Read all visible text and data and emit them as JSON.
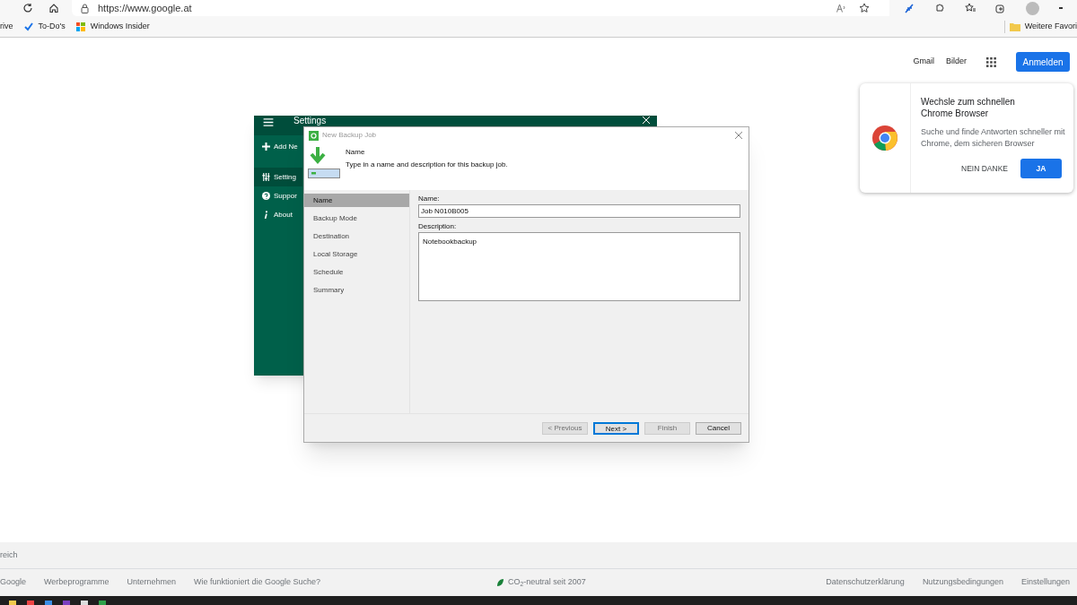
{
  "browser": {
    "url": "https://www.google.at",
    "favorites": [
      {
        "label": "rive",
        "kind": "text"
      },
      {
        "label": "To-Do's",
        "kind": "todo"
      },
      {
        "label": "Windows Insider",
        "kind": "windows"
      }
    ],
    "more_favorites": "Weitere Favori"
  },
  "google": {
    "links": [
      "Gmail",
      "Bilder"
    ],
    "sign_in": "Anmelden"
  },
  "settings_window": {
    "title": "Settings",
    "items": [
      {
        "label": "Add Ne",
        "selected": false
      },
      {
        "label": "Setting",
        "selected": true
      },
      {
        "label": "Suppor",
        "selected": false
      },
      {
        "label": "About",
        "selected": false
      }
    ]
  },
  "dialog": {
    "title": "New Backup Job",
    "heading": "Name",
    "subheading": "Type in a name and description for this backup job.",
    "steps": [
      {
        "label": "Name",
        "selected": true
      },
      {
        "label": "Backup Mode",
        "selected": false
      },
      {
        "label": "Destination",
        "selected": false
      },
      {
        "label": "Local Storage",
        "selected": false
      },
      {
        "label": "Schedule",
        "selected": false
      },
      {
        "label": "Summary",
        "selected": false
      }
    ],
    "name_label": "Name:",
    "name_value": "Job N010B005",
    "description_label": "Description:",
    "description_value": "Notebookbackup",
    "buttons": [
      {
        "label": "< Previous",
        "disabled": true,
        "default": false
      },
      {
        "label": "Next >",
        "disabled": false,
        "default": true
      },
      {
        "label": "Finish",
        "disabled": true,
        "default": false
      },
      {
        "label": "Cancel",
        "disabled": false,
        "default": false
      }
    ]
  },
  "chrome_promo": {
    "title": "Wechsle zum schnellen Chrome Browser",
    "text": "Suche und finde Antworten schneller mit Chrome, dem sicheren Browser",
    "dismiss": "NEIN DANKE",
    "accept": "JA"
  },
  "footer": {
    "country": "reich",
    "left_links": [
      "Google",
      "Werbeprogramme",
      "Unternehmen",
      "Wie funktioniert die Google Suche?"
    ],
    "carbon": "CO$_{2}$-neutral seit 2007",
    "right_links": [
      "Datenschutzerklärung",
      "Nutzungsbedingungen",
      "Einstellungen"
    ]
  }
}
